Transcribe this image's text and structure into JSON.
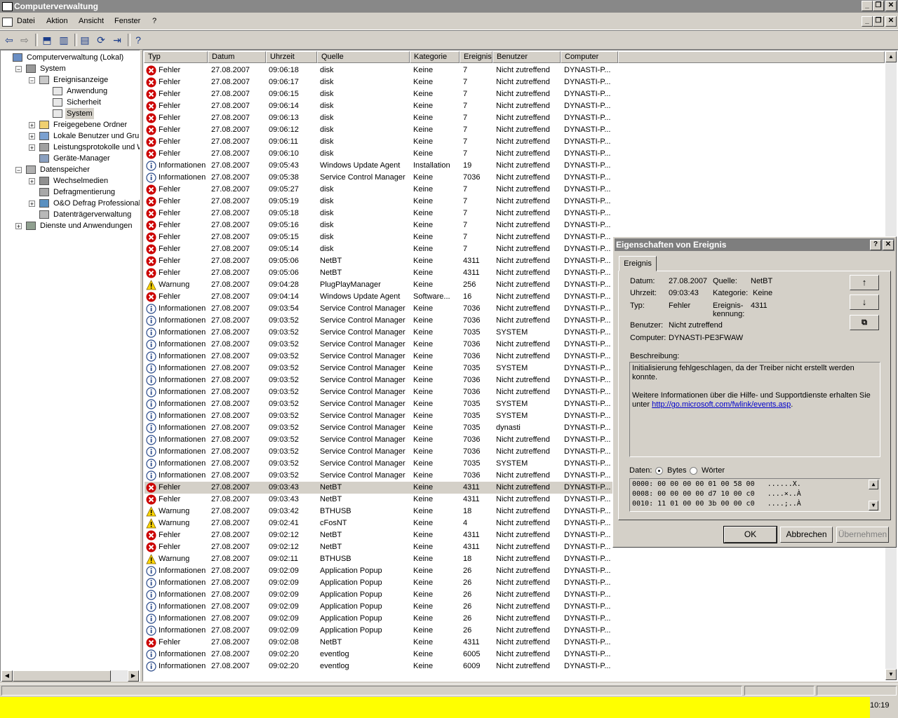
{
  "window": {
    "title": "Computerverwaltung"
  },
  "menu": [
    "Datei",
    "Aktion",
    "Ansicht",
    "Fenster",
    "?"
  ],
  "tree": [
    {
      "label": "Computerverwaltung (Lokal)",
      "icon": "computer-icon",
      "indent": 0,
      "exp": ""
    },
    {
      "label": "System",
      "icon": "tools-icon",
      "indent": 1,
      "exp": "−"
    },
    {
      "label": "Ereignisanzeige",
      "icon": "event-viewer-icon",
      "indent": 2,
      "exp": "−"
    },
    {
      "label": "Anwendung",
      "icon": "log-icon",
      "indent": 3,
      "exp": ""
    },
    {
      "label": "Sicherheit",
      "icon": "log-icon",
      "indent": 3,
      "exp": ""
    },
    {
      "label": "System",
      "icon": "log-icon",
      "indent": 3,
      "exp": "",
      "selected": true
    },
    {
      "label": "Freigegebene Ordner",
      "icon": "folder-icon",
      "indent": 2,
      "exp": "+"
    },
    {
      "label": "Lokale Benutzer und Gruppen",
      "icon": "users-icon",
      "indent": 2,
      "exp": "+"
    },
    {
      "label": "Leistungsprotokolle und Warnu",
      "icon": "performance-icon",
      "indent": 2,
      "exp": "+"
    },
    {
      "label": "Geräte-Manager",
      "icon": "device-icon",
      "indent": 2,
      "exp": ""
    },
    {
      "label": "Datenspeicher",
      "icon": "storage-icon",
      "indent": 1,
      "exp": "−"
    },
    {
      "label": "Wechselmedien",
      "icon": "media-icon",
      "indent": 2,
      "exp": "+"
    },
    {
      "label": "Defragmentierung",
      "icon": "defrag-icon",
      "indent": 2,
      "exp": ""
    },
    {
      "label": "O&O Defrag Professional Edi",
      "icon": "defrag-pro-icon",
      "indent": 2,
      "exp": "+"
    },
    {
      "label": "Datenträgerverwaltung",
      "icon": "disk-mgmt-icon",
      "indent": 2,
      "exp": ""
    },
    {
      "label": "Dienste und Anwendungen",
      "icon": "services-icon",
      "indent": 1,
      "exp": "+"
    }
  ],
  "columns": [
    "Typ",
    "Datum",
    "Uhrzeit",
    "Quelle",
    "Kategorie",
    "Ereignis",
    "Benutzer",
    "Computer"
  ],
  "events": [
    [
      "Fehler",
      "27.08.2007",
      "09:06:18",
      "disk",
      "Keine",
      "7",
      "Nicht zutreffend",
      "DYNASTI-P..."
    ],
    [
      "Fehler",
      "27.08.2007",
      "09:06:17",
      "disk",
      "Keine",
      "7",
      "Nicht zutreffend",
      "DYNASTI-P..."
    ],
    [
      "Fehler",
      "27.08.2007",
      "09:06:15",
      "disk",
      "Keine",
      "7",
      "Nicht zutreffend",
      "DYNASTI-P..."
    ],
    [
      "Fehler",
      "27.08.2007",
      "09:06:14",
      "disk",
      "Keine",
      "7",
      "Nicht zutreffend",
      "DYNASTI-P..."
    ],
    [
      "Fehler",
      "27.08.2007",
      "09:06:13",
      "disk",
      "Keine",
      "7",
      "Nicht zutreffend",
      "DYNASTI-P..."
    ],
    [
      "Fehler",
      "27.08.2007",
      "09:06:12",
      "disk",
      "Keine",
      "7",
      "Nicht zutreffend",
      "DYNASTI-P..."
    ],
    [
      "Fehler",
      "27.08.2007",
      "09:06:11",
      "disk",
      "Keine",
      "7",
      "Nicht zutreffend",
      "DYNASTI-P..."
    ],
    [
      "Fehler",
      "27.08.2007",
      "09:06:10",
      "disk",
      "Keine",
      "7",
      "Nicht zutreffend",
      "DYNASTI-P..."
    ],
    [
      "Informationen",
      "27.08.2007",
      "09:05:43",
      "Windows Update Agent",
      "Installation",
      "19",
      "Nicht zutreffend",
      "DYNASTI-P..."
    ],
    [
      "Informationen",
      "27.08.2007",
      "09:05:38",
      "Service Control Manager",
      "Keine",
      "7036",
      "Nicht zutreffend",
      "DYNASTI-P..."
    ],
    [
      "Fehler",
      "27.08.2007",
      "09:05:27",
      "disk",
      "Keine",
      "7",
      "Nicht zutreffend",
      "DYNASTI-P..."
    ],
    [
      "Fehler",
      "27.08.2007",
      "09:05:19",
      "disk",
      "Keine",
      "7",
      "Nicht zutreffend",
      "DYNASTI-P..."
    ],
    [
      "Fehler",
      "27.08.2007",
      "09:05:18",
      "disk",
      "Keine",
      "7",
      "Nicht zutreffend",
      "DYNASTI-P..."
    ],
    [
      "Fehler",
      "27.08.2007",
      "09:05:16",
      "disk",
      "Keine",
      "7",
      "Nicht zutreffend",
      "DYNASTI-P..."
    ],
    [
      "Fehler",
      "27.08.2007",
      "09:05:15",
      "disk",
      "Keine",
      "7",
      "Nicht zutreffend",
      "DYNASTI-P..."
    ],
    [
      "Fehler",
      "27.08.2007",
      "09:05:14",
      "disk",
      "Keine",
      "7",
      "Nicht zutreffend",
      "DYNASTI-P..."
    ],
    [
      "Fehler",
      "27.08.2007",
      "09:05:06",
      "NetBT",
      "Keine",
      "4311",
      "Nicht zutreffend",
      "DYNASTI-P..."
    ],
    [
      "Fehler",
      "27.08.2007",
      "09:05:06",
      "NetBT",
      "Keine",
      "4311",
      "Nicht zutreffend",
      "DYNASTI-P..."
    ],
    [
      "Warnung",
      "27.08.2007",
      "09:04:28",
      "PlugPlayManager",
      "Keine",
      "256",
      "Nicht zutreffend",
      "DYNASTI-P..."
    ],
    [
      "Fehler",
      "27.08.2007",
      "09:04:14",
      "Windows Update Agent",
      "Software...",
      "16",
      "Nicht zutreffend",
      "DYNASTI-P..."
    ],
    [
      "Informationen",
      "27.08.2007",
      "09:03:54",
      "Service Control Manager",
      "Keine",
      "7036",
      "Nicht zutreffend",
      "DYNASTI-P..."
    ],
    [
      "Informationen",
      "27.08.2007",
      "09:03:52",
      "Service Control Manager",
      "Keine",
      "7036",
      "Nicht zutreffend",
      "DYNASTI-P..."
    ],
    [
      "Informationen",
      "27.08.2007",
      "09:03:52",
      "Service Control Manager",
      "Keine",
      "7035",
      "SYSTEM",
      "DYNASTI-P..."
    ],
    [
      "Informationen",
      "27.08.2007",
      "09:03:52",
      "Service Control Manager",
      "Keine",
      "7036",
      "Nicht zutreffend",
      "DYNASTI-P..."
    ],
    [
      "Informationen",
      "27.08.2007",
      "09:03:52",
      "Service Control Manager",
      "Keine",
      "7036",
      "Nicht zutreffend",
      "DYNASTI-P..."
    ],
    [
      "Informationen",
      "27.08.2007",
      "09:03:52",
      "Service Control Manager",
      "Keine",
      "7035",
      "SYSTEM",
      "DYNASTI-P..."
    ],
    [
      "Informationen",
      "27.08.2007",
      "09:03:52",
      "Service Control Manager",
      "Keine",
      "7036",
      "Nicht zutreffend",
      "DYNASTI-P..."
    ],
    [
      "Informationen",
      "27.08.2007",
      "09:03:52",
      "Service Control Manager",
      "Keine",
      "7036",
      "Nicht zutreffend",
      "DYNASTI-P..."
    ],
    [
      "Informationen",
      "27.08.2007",
      "09:03:52",
      "Service Control Manager",
      "Keine",
      "7035",
      "SYSTEM",
      "DYNASTI-P..."
    ],
    [
      "Informationen",
      "27.08.2007",
      "09:03:52",
      "Service Control Manager",
      "Keine",
      "7035",
      "SYSTEM",
      "DYNASTI-P..."
    ],
    [
      "Informationen",
      "27.08.2007",
      "09:03:52",
      "Service Control Manager",
      "Keine",
      "7035",
      "dynasti",
      "DYNASTI-P..."
    ],
    [
      "Informationen",
      "27.08.2007",
      "09:03:52",
      "Service Control Manager",
      "Keine",
      "7036",
      "Nicht zutreffend",
      "DYNASTI-P..."
    ],
    [
      "Informationen",
      "27.08.2007",
      "09:03:52",
      "Service Control Manager",
      "Keine",
      "7036",
      "Nicht zutreffend",
      "DYNASTI-P..."
    ],
    [
      "Informationen",
      "27.08.2007",
      "09:03:52",
      "Service Control Manager",
      "Keine",
      "7035",
      "SYSTEM",
      "DYNASTI-P..."
    ],
    [
      "Informationen",
      "27.08.2007",
      "09:03:52",
      "Service Control Manager",
      "Keine",
      "7036",
      "Nicht zutreffend",
      "DYNASTI-P..."
    ],
    [
      "Fehler",
      "27.08.2007",
      "09:03:43",
      "NetBT",
      "Keine",
      "4311",
      "Nicht zutreffend",
      "DYNASTI-P..."
    ],
    [
      "Fehler",
      "27.08.2007",
      "09:03:43",
      "NetBT",
      "Keine",
      "4311",
      "Nicht zutreffend",
      "DYNASTI-P..."
    ],
    [
      "Warnung",
      "27.08.2007",
      "09:03:42",
      "BTHUSB",
      "Keine",
      "18",
      "Nicht zutreffend",
      "DYNASTI-P..."
    ],
    [
      "Warnung",
      "27.08.2007",
      "09:02:41",
      "cFosNT",
      "Keine",
      "4",
      "Nicht zutreffend",
      "DYNASTI-P..."
    ],
    [
      "Fehler",
      "27.08.2007",
      "09:02:12",
      "NetBT",
      "Keine",
      "4311",
      "Nicht zutreffend",
      "DYNASTI-P..."
    ],
    [
      "Fehler",
      "27.08.2007",
      "09:02:12",
      "NetBT",
      "Keine",
      "4311",
      "Nicht zutreffend",
      "DYNASTI-P..."
    ],
    [
      "Warnung",
      "27.08.2007",
      "09:02:11",
      "BTHUSB",
      "Keine",
      "18",
      "Nicht zutreffend",
      "DYNASTI-P..."
    ],
    [
      "Informationen",
      "27.08.2007",
      "09:02:09",
      "Application Popup",
      "Keine",
      "26",
      "Nicht zutreffend",
      "DYNASTI-P..."
    ],
    [
      "Informationen",
      "27.08.2007",
      "09:02:09",
      "Application Popup",
      "Keine",
      "26",
      "Nicht zutreffend",
      "DYNASTI-P..."
    ],
    [
      "Informationen",
      "27.08.2007",
      "09:02:09",
      "Application Popup",
      "Keine",
      "26",
      "Nicht zutreffend",
      "DYNASTI-P..."
    ],
    [
      "Informationen",
      "27.08.2007",
      "09:02:09",
      "Application Popup",
      "Keine",
      "26",
      "Nicht zutreffend",
      "DYNASTI-P..."
    ],
    [
      "Informationen",
      "27.08.2007",
      "09:02:09",
      "Application Popup",
      "Keine",
      "26",
      "Nicht zutreffend",
      "DYNASTI-P..."
    ],
    [
      "Informationen",
      "27.08.2007",
      "09:02:09",
      "Application Popup",
      "Keine",
      "26",
      "Nicht zutreffend",
      "DYNASTI-P..."
    ],
    [
      "Fehler",
      "27.08.2007",
      "09:02:08",
      "NetBT",
      "Keine",
      "4311",
      "Nicht zutreffend",
      "DYNASTI-P..."
    ],
    [
      "Informationen",
      "27.08.2007",
      "09:02:20",
      "eventlog",
      "Keine",
      "6005",
      "Nicht zutreffend",
      "DYNASTI-P..."
    ],
    [
      "Informationen",
      "27.08.2007",
      "09:02:20",
      "eventlog",
      "Keine",
      "6009",
      "Nicht zutreffend",
      "DYNASTI-P..."
    ]
  ],
  "selected_event_index": 35,
  "dialog": {
    "title": "Eigenschaften von Ereignis",
    "tab": "Ereignis",
    "datum_label": "Datum:",
    "datum": "27.08.2007",
    "uhrzeit_label": "Uhrzeit:",
    "uhrzeit": "09:03:43",
    "typ_label": "Typ:",
    "typ": "Fehler",
    "quelle_label": "Quelle:",
    "quelle": "NetBT",
    "kategorie_label": "Kategorie:",
    "kategorie": "Keine",
    "kennung_label1": "Ereignis-",
    "kennung_label2": "kennung:",
    "kennung": "4311",
    "benutzer_label": "Benutzer:",
    "benutzer": "Nicht zutreffend",
    "computer_label": "Computer:",
    "computer": "DYNASTI-PE3FWAW",
    "beschreibung_label": "Beschreibung:",
    "desc_line1": "Initialisierung fehlgeschlagen, da der Treiber nicht erstellt werden konnte.",
    "desc_line2": "Weitere Informationen über die Hilfe- und Supportdienste erhalten Sie",
    "desc_line3_prefix": "unter ",
    "desc_link": "http://go.microsoft.com/fwlink/events.asp",
    "desc_line3_suffix": ".",
    "daten_label": "Daten:",
    "bytes_label": "Bytes",
    "woerter_label": "Wörter",
    "data_lines": [
      "0000: 00 00 00 00 01 00 58 00   ......X.",
      "0008: 00 00 00 00 d7 10 00 c0   ....×..À",
      "0010: 11 01 00 00 3b 00 00 c0   ....;..À"
    ],
    "ok": "OK",
    "abbrechen": "Abbrechen",
    "uebernehmen": "Übernehmen"
  },
  "clock": "10:19",
  "colors": {
    "error": "#cc0000",
    "warning": "#ffd800",
    "info": "#ffffff",
    "selection": "#d4d0c8",
    "highlight_bar": "#ffff00"
  }
}
